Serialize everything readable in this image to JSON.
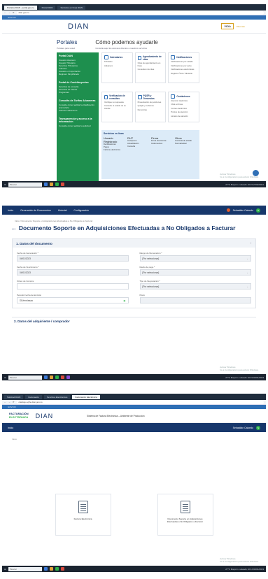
{
  "screen1": {
    "tabs": [
      "Portales DIAN - portal.gov.co",
      "Portal DIAN",
      "Servicios en línea DIAN"
    ],
    "url": "dian.gov.co",
    "govbar": "GOV.CO",
    "logo": "DIAN",
    "vida": "VIDA",
    "vida_tag": "#Sumate",
    "portales_title": "Portales",
    "portales_sub": "Portales para usted",
    "help_title": "Cómo podemos ayudarle",
    "help_sub": "Consulte aquí los accesos directos a nuestros servicios",
    "left_groups": [
      {
        "title": "Portal DIAN",
        "items": [
          "Usuario Aduanero",
          "Usuario Tributario",
          "Servicios Tributarios",
          "Trámites",
          "Usuario en Importación",
          "Régimen Simplificado"
        ]
      },
      {
        "title": "Portal de Contribuyentes",
        "items": [
          "Servicios de consulta",
          "Servicios de trámite",
          "Programas"
        ]
      },
      {
        "title": "Consulta de Tarifas Aduaneras",
        "items": [
          "Consulte cómo realizar la clasificación arancelaria",
          "Cálculos aduaneros"
        ]
      },
      {
        "title": "Transparencia y acceso a la información",
        "items": [
          "Consulte cómo realizar la solicitud"
        ]
      }
    ],
    "cards": [
      {
        "title": "Calendarios",
        "items": [
          "Tributario",
          "Aduanero"
        ]
      },
      {
        "title": "Agendamiento de citas",
        "items": [
          "Citas de agendamiento en línea",
          "Consultar mis citas"
        ]
      },
      {
        "title": "Notificaciones",
        "items": [
          "Notificaciones por estado",
          "Notificaciones por aviso",
          "Notificaciones electrónicas",
          "Registro Único Tributario"
        ]
      },
      {
        "title": "Verificación de consultas",
        "items": [
          "Verifique su respuesta",
          "Consulte el estado de su trámite"
        ]
      },
      {
        "title": "PQSR y Denuncias",
        "items": [
          "Presentación de peticiones",
          "Quejas y reclamos",
          "Denuncias"
        ]
      },
      {
        "title": "Contáctenos",
        "items": [
          "Atención telefónica",
          "Chat en línea",
          "Correo electrónico",
          "Puntos de atención",
          "Horario de atención"
        ]
      }
    ],
    "services_title": "Servicios en línea",
    "services": [
      {
        "title": "Usuario Registrado",
        "items": [
          "Declaraciones",
          "Pagos",
          "Factura electrónica"
        ]
      },
      {
        "title": "RUT",
        "items": [
          "Inscripción",
          "Actualización",
          "Consulta"
        ]
      },
      {
        "title": "Firma",
        "items": [
          "Firma electrónica",
          "Instrumentos"
        ]
      },
      {
        "title": "Otros",
        "items": [
          "Consulta de estado",
          "Normatividad"
        ]
      }
    ],
    "taskbar_search": "Buscar",
    "tray": "27°C Mayorm. soleado   10:15   27/02/2021",
    "watermark": [
      "Activar Windows",
      "Ve a Configuración para activar Windows."
    ]
  },
  "screen2": {
    "nav": [
      "Inicio",
      "Generación de Documentos",
      "Historial",
      "Configuración"
    ],
    "user": "Sebastián Caicedo",
    "avatar": "S",
    "breadcrumb": "Inicio / Documento Soporte en Adquisiciones Efectuadas a No Obligados a Facturar",
    "title": "Documento Soporte en Adquisiciones Efectuadas a No Obligados a Facturar",
    "section1": "1. Datos del documento",
    "fields": [
      {
        "label": "Fecha de Generación *",
        "value": "04/01/2023",
        "select": false,
        "white": false
      },
      {
        "label": "Rango de Numeración *",
        "value": "[Por seleccionar]",
        "select": true,
        "white": false
      },
      {
        "label": "Fecha de Vencimiento *",
        "value": "04/01/2023",
        "select": false,
        "white": false
      },
      {
        "label": "Medio de pago *",
        "value": "[Por seleccionar]",
        "select": true,
        "white": false
      },
      {
        "label": "Orden de Compra",
        "value": "",
        "select": false,
        "white": true
      },
      {
        "label": "Tipo de Negociación *",
        "value": "[Por seleccionar]",
        "select": true,
        "white": false
      },
      {
        "label": "Periodo Fecha de Emisión",
        "value": "DD/mm/aaaa",
        "select": false,
        "white": true
      },
      {
        "label": "Plazo",
        "value": "",
        "select": false,
        "white": false
      }
    ],
    "section2": "2. Datos del adquiriente / comprador",
    "taskbar_search": "Buscar",
    "tray": "27°C Mayorm. soleado   10:19   04/01/2023",
    "watermark": [
      "Activar Windows",
      "Ve a Configuración para activar Windows."
    ]
  },
  "screen3": {
    "tabs": [
      "Solicitud DIAN",
      "Facturación",
      "Servicios Electrónicos",
      "Facturación Electrónica"
    ],
    "url": "catalogo-vpfe.dian.gov.co",
    "govbar": "GOV.CO",
    "fe_line1": "FACTURACIÓN",
    "fe_line2": "ELECTRÓNICA",
    "logo": "DIAN",
    "sistema": "Sistema de Factura Electrónica – Ambiente de Producción",
    "nav_home": "Inicio",
    "user": "Sebastián Caicedo",
    "avatar": "S",
    "crumb": "Inicio",
    "tiles": [
      "Factura Electrónica",
      "Documento Soporte en Adquisiciones Efectuadas a No Obligados a Facturar"
    ],
    "taskbar_search": "Buscar",
    "tray": "27°C Mayorm. soleado   10:14   04/01/2023",
    "watermark": [
      "Activar Windows",
      "Ve a Configuración para activar Windows."
    ]
  }
}
